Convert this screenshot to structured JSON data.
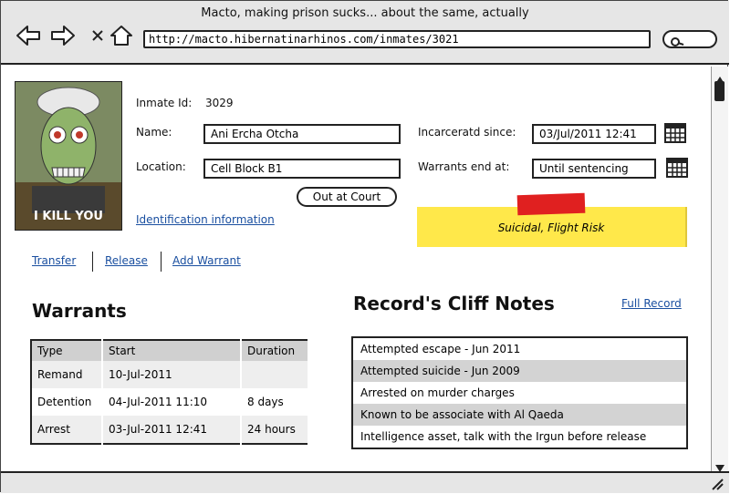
{
  "window": {
    "title": "Macto, making prison sucks... about the same, actually",
    "url": "http://macto.hibernatinarhinos.com/inmates/3021"
  },
  "photo": {
    "caption": "I KILL YOU"
  },
  "inmate": {
    "id_label": "Inmate Id:",
    "id_value": "3029",
    "name_label": "Name:",
    "name_value": "Ani Ercha Otcha",
    "location_label": "Location:",
    "location_value": "Cell Block B1",
    "location_callout": "Out at Court",
    "incarcerated_label": "Incarceratd since:",
    "incarcerated_value": "03/Jul/2011 12:41",
    "warrants_end_label": "Warrants end at:",
    "warrants_end_value": "Until sentencing",
    "identification_link": "Identification information",
    "sticky_note": "Suicidal, Flight Risk"
  },
  "actions": [
    "Transfer",
    "Release",
    "Add Warrant"
  ],
  "warrants": {
    "heading": "Warrants",
    "columns": [
      "Type",
      "Start",
      "Duration"
    ],
    "rows": [
      [
        "Remand",
        "10-Jul-2011",
        ""
      ],
      [
        "Detention",
        "04-Jul-2011 11:10",
        "8 days"
      ],
      [
        "Arrest",
        "03-Jul-2011 12:41",
        "24 hours"
      ]
    ]
  },
  "cliff_notes": {
    "heading": "Record's Cliff Notes",
    "full_record_link": "Full Record",
    "items": [
      "Attempted escape - Jun 2011",
      "Attempted suicide - Jun 2009",
      "Arrested on murder charges",
      "Known to be associate with Al Qaeda",
      "Intelligence asset, talk with the Irgun before release"
    ]
  },
  "icons": {
    "back": "back-arrow-icon",
    "forward": "forward-arrow-icon",
    "close": "close-icon",
    "home": "home-icon",
    "search": "search-icon",
    "calendar": "calendar-icon",
    "resize": "resize-grip-icon"
  }
}
